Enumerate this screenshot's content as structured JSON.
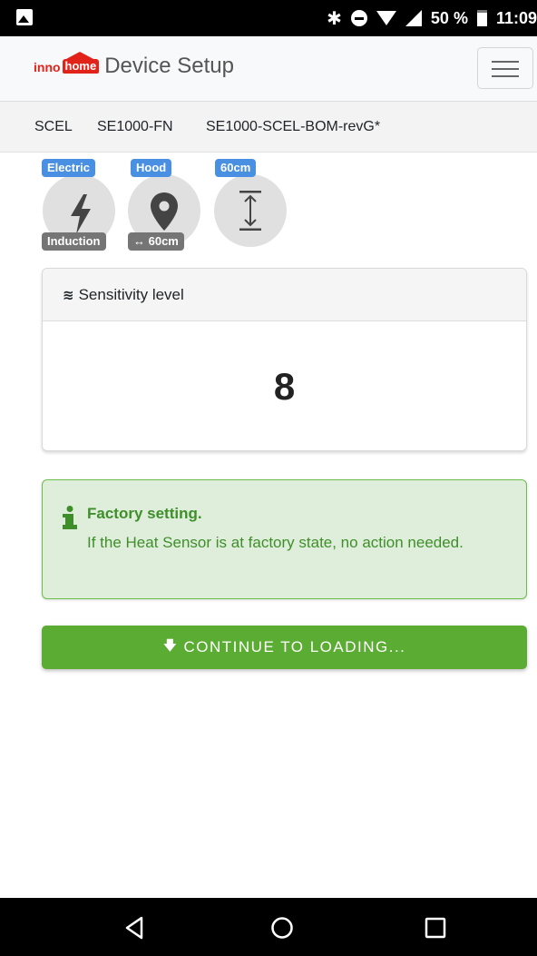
{
  "status_bar": {
    "battery": "50 %",
    "time": "11:09",
    "icons": [
      "gallery-icon",
      "bluetooth-icon",
      "do-not-disturb-icon",
      "wifi-icon",
      "signal-icon",
      "battery-icon"
    ]
  },
  "navbar": {
    "logo_inno": "inno",
    "logo_home": "home",
    "title": "Device Setup",
    "menu_icon": "hamburger-menu-icon"
  },
  "breadcrumb": {
    "item1": "SCEL",
    "item2": "SE1000-FN",
    "item3": "SE1000-SCEL-BOM-revG*"
  },
  "device_icons": {
    "energy": {
      "top_badge": "Electric",
      "bottom_badge": "Induction",
      "icon": "lightning-bolt-icon"
    },
    "location": {
      "top_badge": "Hood",
      "bottom_badge": "↔ 60cm",
      "icon": "map-marker-icon"
    },
    "height": {
      "top_badge": "60cm",
      "icon": "vertical-distance-icon"
    }
  },
  "sensitivity": {
    "header_label": "Sensitivity level",
    "value": "8"
  },
  "alert": {
    "title": "Factory setting.",
    "text": "If the Heat Sensor is at factory state, no action needed."
  },
  "continue_button": {
    "label": "CONTINUE TO LOADING..."
  },
  "colors": {
    "primary_green": "#5aad32",
    "alert_bg": "#dfeedb",
    "alert_text": "#3e8f2a",
    "badge_blue": "#4a90e2",
    "badge_gray": "#757575",
    "logo_red": "#e2231a"
  }
}
